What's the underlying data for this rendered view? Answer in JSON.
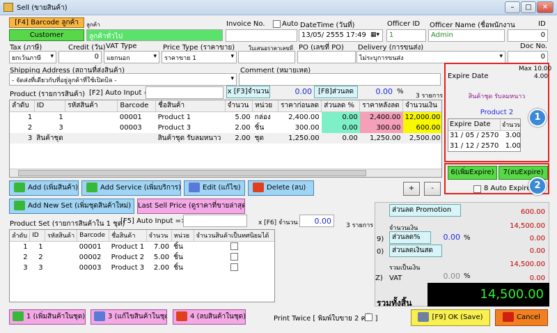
{
  "window": {
    "title": "Sell (ขายสินค้า)",
    "min": "–",
    "max": "□",
    "close": "✕"
  },
  "header": {
    "barcode_btn": "[F4] Barcode ลูกค้า",
    "customer_label": "ลูกค้า",
    "customer_btn": "Customer",
    "customer_name": "ลูกค้าทั่วไป",
    "invoice_label": "Invoice No.",
    "invoice_value": "",
    "auto_label": "Auto",
    "datetime_label": "DateTime (วันที่)",
    "datetime_value": "13/05/  2555 17:49",
    "officer_id_label": "Officer ID",
    "officer_id_value": "1",
    "officer_name_label": "Officer Name (ชื่อพนักงาน",
    "officer_name_value": "Admin",
    "id_label": "ID",
    "id_value": "0",
    "tax_label": "Tax (ภาษี)",
    "tax_value": "ยกเว้นภาษี",
    "credit_label": "Credit (วัน)",
    "credit_value": "0",
    "vat_label": "VAT Type",
    "vat_value": "แยกนอก",
    "price_type_label": "Price Type (ราคาขาย)",
    "price_type_value": "ราคาขาย 1",
    "quote_label": "ใบเสนอราคาเลขที่",
    "quote_value": "",
    "po_label": "PO (เลขที่ PO)",
    "po_value": "",
    "delivery_label": "Delivery (การขนส่ง)",
    "delivery_value": "ไม่ระบุการขนส่ง",
    "docno_label": "Doc No.",
    "docno_value": "0",
    "ship_label": "Shipping Address (สถานที่ส่งสินค้า)",
    "ship_value": "- จัดส่งที่เดียวกับที่อยู่ลูกค้าที่ใช้เปิดบิล -",
    "comment_label": "Comment (หมายเหตุ)",
    "comment_value": ""
  },
  "products": {
    "label": "Product (รายการสินค้า)",
    "f2_label": "[F2] Auto Input =>",
    "f3_btn": "x [F3]จำนวน",
    "f3_value": "0.00",
    "f8_btn": "[F8]ส่วนลด",
    "f8_value": "0.00",
    "pct": "%",
    "count": "3 รายการ",
    "columns": [
      "ลำดับ",
      "ID",
      "รหัสสินค้า",
      "Barcode",
      "ชื่อสินค้า",
      "จำนวน",
      "หน่วย",
      "ราคาก่อนลด",
      "ส่วนลด %",
      "ราคาหลังลด",
      "จำนวนเงิน"
    ],
    "rows": [
      [
        "1",
        "1",
        "",
        "00001",
        "Product 1",
        "5.00",
        "กล่อง",
        "2,400.00",
        "0.00",
        "2,400.00",
        "12,000.00"
      ],
      [
        "2",
        "3",
        "",
        "00003",
        "Product 3",
        "2.00",
        "ชิ้น",
        "300.00",
        "0.00",
        "300.00",
        "600.00"
      ],
      [
        "3",
        "สินค้าชุด",
        "",
        "",
        "สินค้าชุด รับลมหนาว",
        "2.00",
        "ชุด",
        "1,250.00",
        "0.00",
        "1,250.00",
        "2,500.00"
      ]
    ]
  },
  "expire": {
    "title": "Expire Date",
    "max_label": "Max 10.00",
    "max_value": "4.00",
    "set_name": "สินค้าชุด รับลมหนาว",
    "product": "Product 2",
    "columns": [
      "Expire Date",
      "จำนวน"
    ],
    "rows": [
      [
        "31 / 05 / 2570",
        "3.00"
      ],
      [
        "31 / 12 / 2570",
        "1.00"
      ]
    ],
    "add_btn": "6(เพิ่มExpire)",
    "del_btn": "7(ลบExpire)",
    "auto_label": "8 Auto Expire",
    "badge1": "1",
    "badge2": "2"
  },
  "actions": {
    "add": "Add (เพิ่มสินค้า)",
    "add_service": "Add Service (เพิ่มบริการ)",
    "edit": "Edit (แก้ไข)",
    "delete": "Delete (ลบ)",
    "plus": "+",
    "minus": "-",
    "add_set": "Add New Set (เพิ่มชุดสินค้าใหม่)",
    "last_price": "Last Sell Price (ดูราคาที่ขายล่าสุด)"
  },
  "set": {
    "label": "Product Set (รายการสินค้าใน 1 ชุด)",
    "f5_label": "[F5] Auto Input =>",
    "f6_label": "x [F6] จำนวน",
    "f6_value": "0.00",
    "count": "3 รายการ",
    "columns": [
      "ลำดับ",
      "ID",
      "รหัสสินค้า",
      "Barcode",
      "ชื่อสินค้า",
      "จำนวน",
      "หน่วย",
      "จำนวนสินค้าเป็นทศนิยมได้"
    ],
    "rows": [
      [
        "1",
        "1",
        "",
        "00001",
        "Product 1",
        "7.00",
        "ชิ้น"
      ],
      [
        "2",
        "2",
        "",
        "00002",
        "Product 2",
        "5.00",
        "ชิ้น"
      ],
      [
        "3",
        "3",
        "",
        "00003",
        "Product 3",
        "2.00",
        "ชิ้น"
      ]
    ]
  },
  "summary": {
    "promotion_btn": "ส่วนลด Promotion",
    "promotion_value": "600.00",
    "amount_label": "จำนวนเงิน",
    "amount_value": "14,500.00",
    "disc_pct_key": "9)",
    "disc_pct_btn": "ส่วนลด%",
    "disc_pct_value": "0.00",
    "disc_pct_total": "0.00",
    "disc_cash_key": "0)",
    "disc_cash_btn": "ส่วนลดเงินสด",
    "disc_cash_value": "0.00",
    "total_label": "รวมเป็นเงิน",
    "total_value": "14,500.00",
    "vat_key": "Z)",
    "vat_label": "VAT",
    "vat_pct": "0.00",
    "vat_value": "0.00",
    "grand_label": "รวมทั้งสิ้น",
    "grand_value": "14,500.00"
  },
  "footer": {
    "add_set_item": "1 (เพิ่มสินค้าในชุด)",
    "edit_set_item": "3 (แก้ไขสินค้าในชุด)",
    "del_set_item": "4 (ลบสินค้าในชุด)",
    "print_twice": "Print Twice [ พิมพ์ใบขาย 2 ครั้ง ]",
    "ok": "[F9] OK (Save)",
    "cancel": "Cancel"
  }
}
